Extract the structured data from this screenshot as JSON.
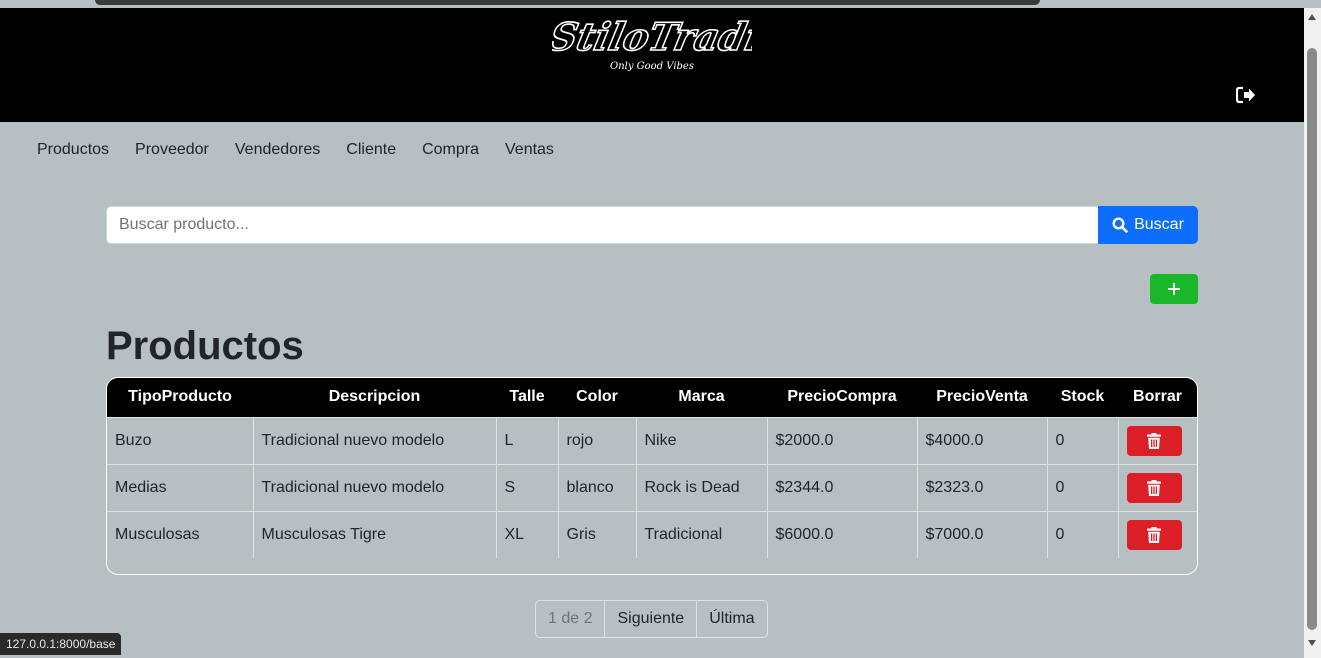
{
  "brand": {
    "logo_text": "StiloTradi",
    "logo_tagline": "Only Good Vibes"
  },
  "header": {
    "logout_icon": "sign-out-icon"
  },
  "nav": {
    "items": [
      "Productos",
      "Proveedor",
      "Vendedores",
      "Cliente",
      "Compra",
      "Ventas"
    ]
  },
  "search": {
    "placeholder": "Buscar producto...",
    "value": "",
    "button_label": "Buscar",
    "button_icon": "search-icon"
  },
  "add_button": {
    "icon": "plus-icon"
  },
  "page_title": "Productos",
  "table": {
    "headers": [
      "TipoProducto",
      "Descripcion",
      "Talle",
      "Color",
      "Marca",
      "PrecioCompra",
      "PrecioVenta",
      "Stock",
      "Borrar"
    ],
    "rows": [
      [
        "Buzo",
        "Tradicional nuevo modelo",
        "L",
        "rojo",
        "Nike",
        "$2000.0",
        "$4000.0",
        "0"
      ],
      [
        "Medias",
        "Tradicional nuevo modelo",
        "S",
        "blanco",
        "Rock is Dead",
        "$2344.0",
        "$2323.0",
        "0"
      ],
      [
        "Musculosas",
        "Musculosas Tigre",
        "XL",
        "Gris",
        "Tradicional",
        "$6000.0",
        "$7000.0",
        "0"
      ]
    ],
    "delete_icon": "trash-icon"
  },
  "pagination": {
    "current": "1 de 2",
    "next": "Siguiente",
    "last": "Última"
  },
  "status_url": "127.0.0.1:8000/base",
  "colors": {
    "header_bg": "#000000",
    "page_bg": "#b6bfc2",
    "primary": "#0d6efd",
    "success": "#18b82a",
    "danger": "#dc1f26"
  }
}
